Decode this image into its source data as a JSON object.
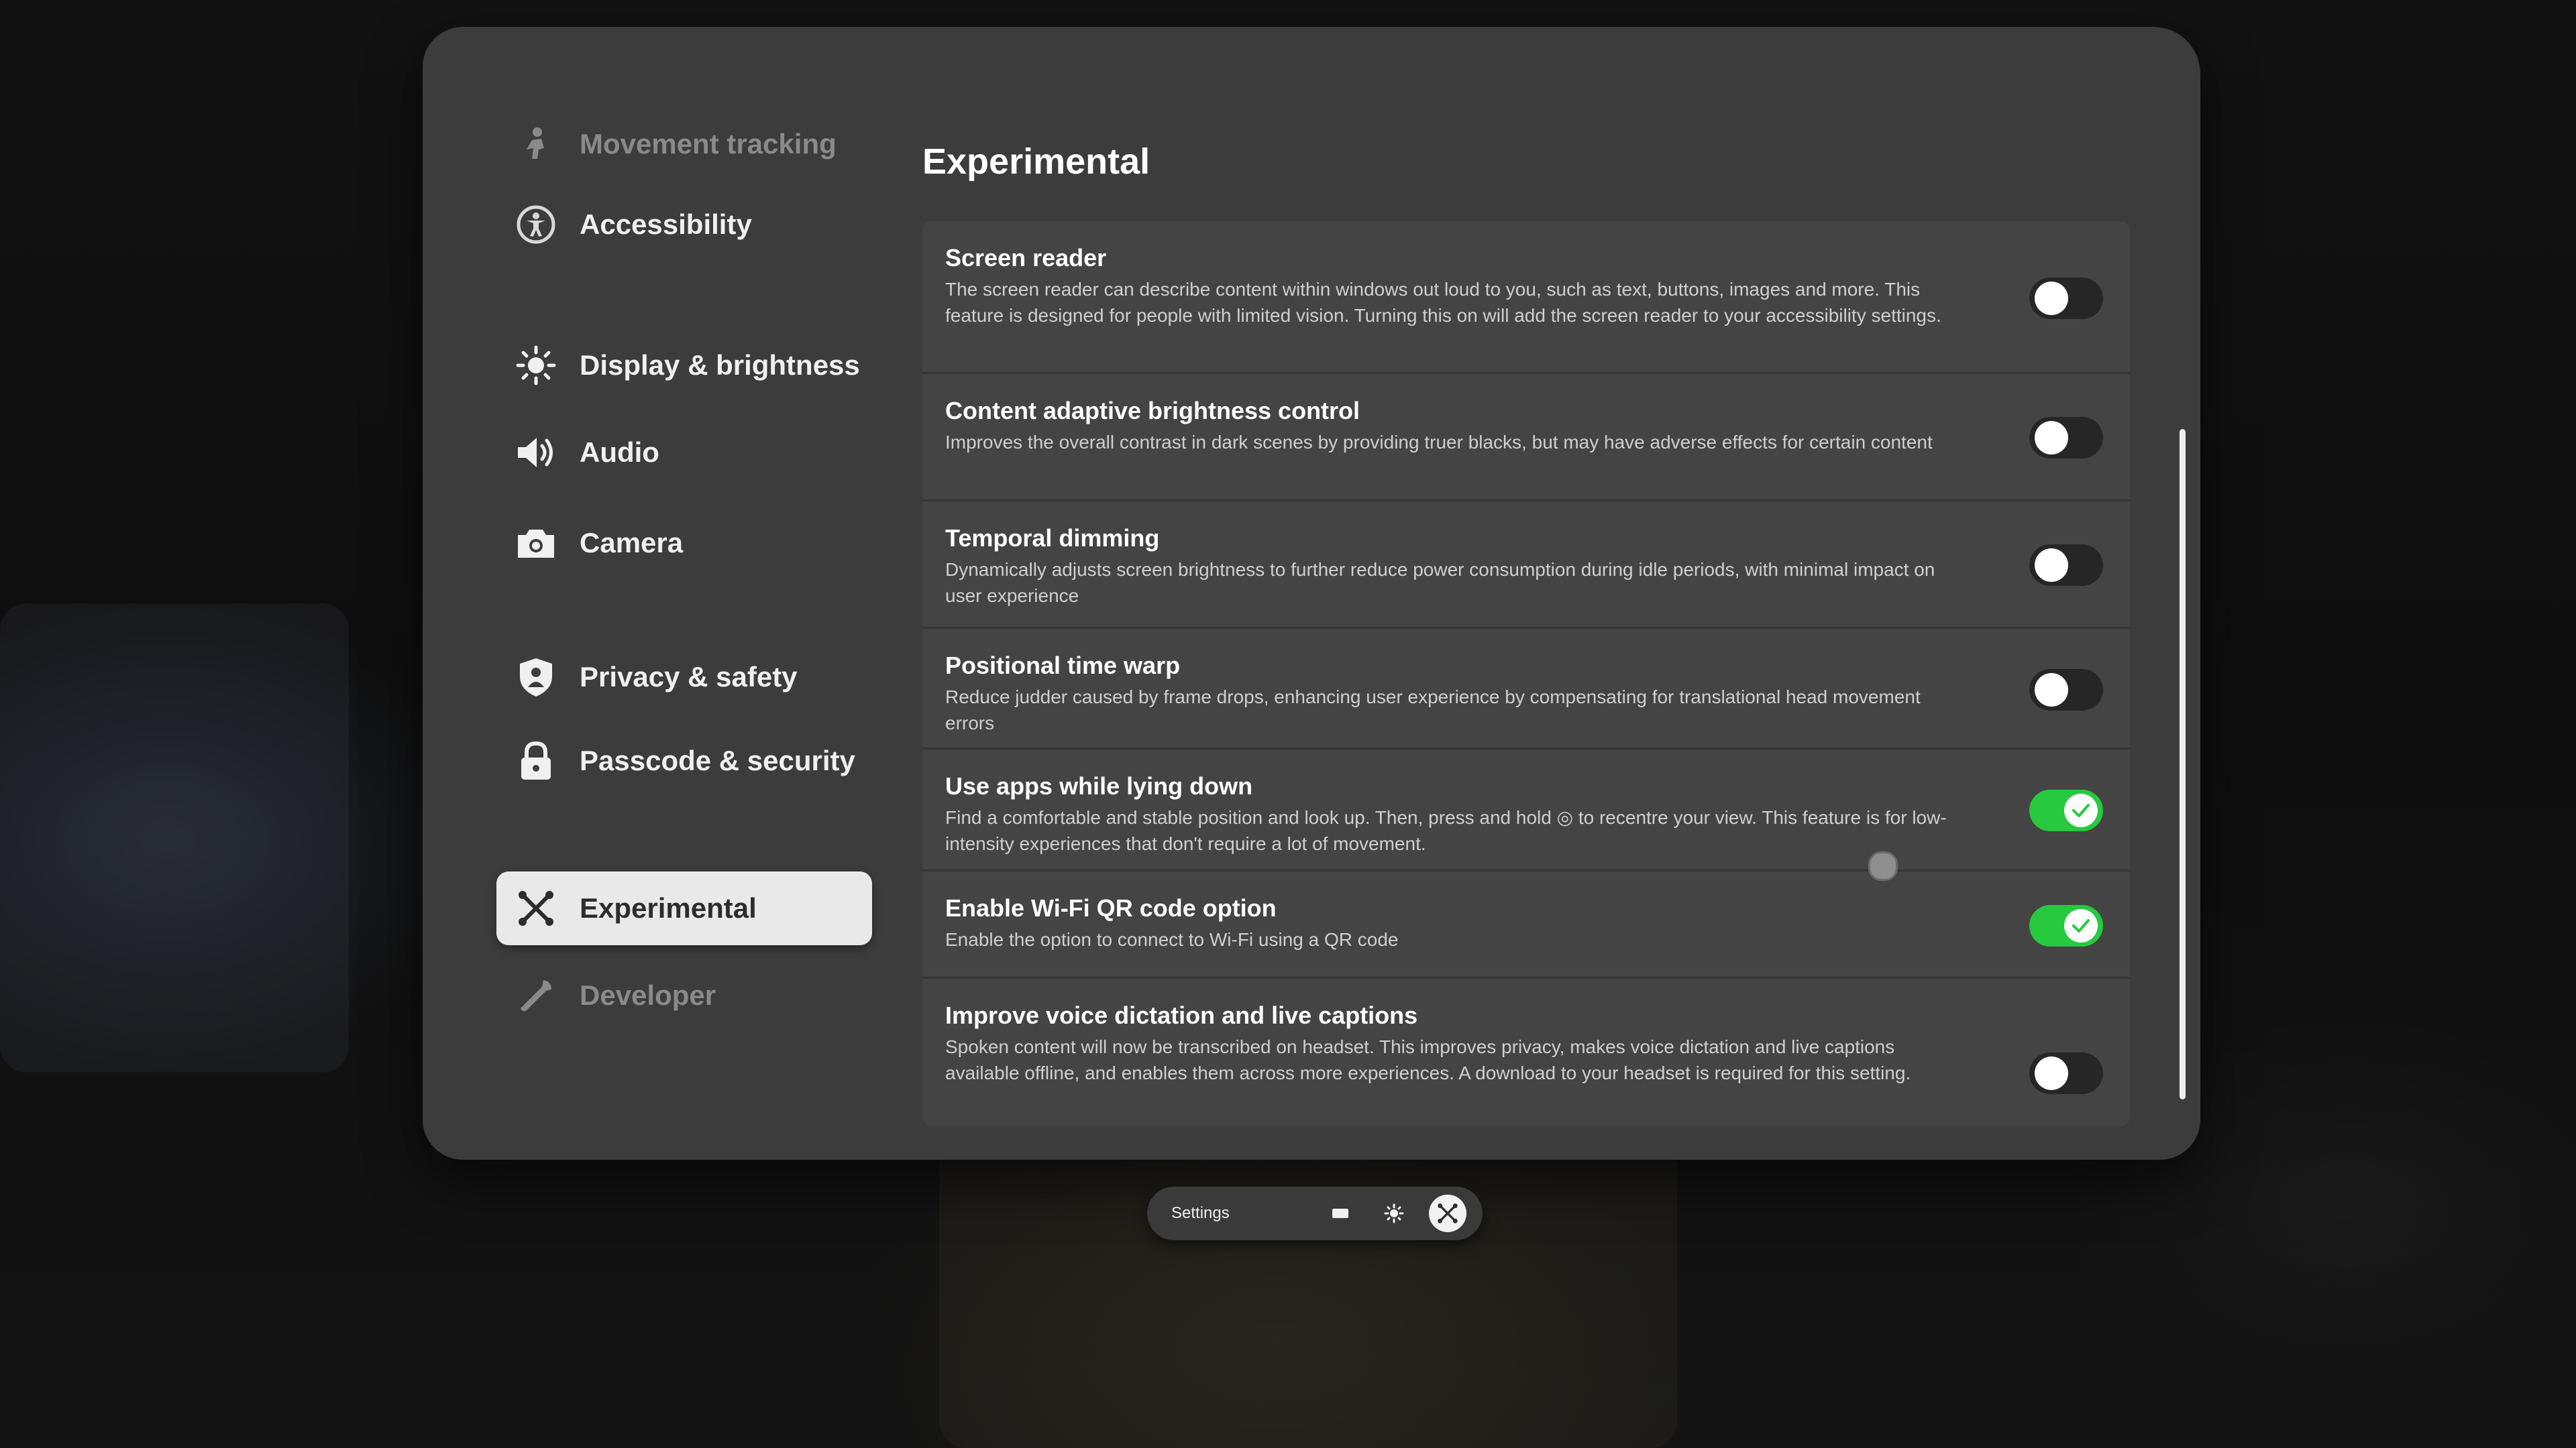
{
  "sidebar": {
    "items": [
      {
        "label": "Movement tracking",
        "icon": "person-walking-icon"
      },
      {
        "label": "Accessibility",
        "icon": "accessibility-icon"
      },
      {
        "label": "Display & brightness",
        "icon": "sun-icon"
      },
      {
        "label": "Audio",
        "icon": "speaker-icon"
      },
      {
        "label": "Camera",
        "icon": "camera-icon"
      },
      {
        "label": "Privacy & safety",
        "icon": "shield-person-icon"
      },
      {
        "label": "Passcode & security",
        "icon": "lock-icon"
      },
      {
        "label": "Experimental",
        "icon": "experimental-icon",
        "selected": true
      },
      {
        "label": "Developer",
        "icon": "wrench-icon"
      }
    ]
  },
  "main": {
    "title": "Experimental",
    "settings": [
      {
        "title": "Screen reader",
        "description": "The screen reader can describe content within windows out loud to you, such as text, buttons, images and more. This feature is designed for people with limited vision. Turning this on will add the screen reader to your accessibility settings.",
        "enabled": false
      },
      {
        "title": "Content adaptive brightness control",
        "description": "Improves the overall contrast in dark scenes by providing truer blacks, but may have adverse effects for certain content",
        "enabled": false
      },
      {
        "title": "Temporal dimming",
        "description": "Dynamically adjusts screen brightness to further reduce power consumption during idle periods, with minimal impact on user experience",
        "enabled": false
      },
      {
        "title": "Positional time warp",
        "description": "Reduce judder caused by frame drops, enhancing user experience by compensating for translational head movement errors",
        "enabled": false
      },
      {
        "title": "Use apps while lying down",
        "description": "Find a comfortable and stable position and look up. Then, press and hold ◎ to recentre your view. This feature is for low-intensity experiences that don't require a lot of movement.",
        "enabled": true
      },
      {
        "title": "Enable Wi-Fi QR code option",
        "description": "Enable the option to connect to Wi-Fi using a QR code",
        "enabled": true
      },
      {
        "title": "Improve voice dictation and live captions",
        "description": "Spoken content will now be transcribed on headset. This improves privacy, makes voice dictation and live captions available offline, and enables them across more experiences. A download to your headset is required for this setting.",
        "enabled": false
      }
    ]
  },
  "taskbar": {
    "label": "Settings",
    "buttons": [
      "window-icon",
      "brightness-icon",
      "experimental-icon"
    ]
  },
  "colors": {
    "panel": "#3c3c3c",
    "row": "#444444",
    "toggle_on": "#27c93f",
    "toggle_off": "#262626",
    "selected_nav": "#e9e9e9"
  }
}
